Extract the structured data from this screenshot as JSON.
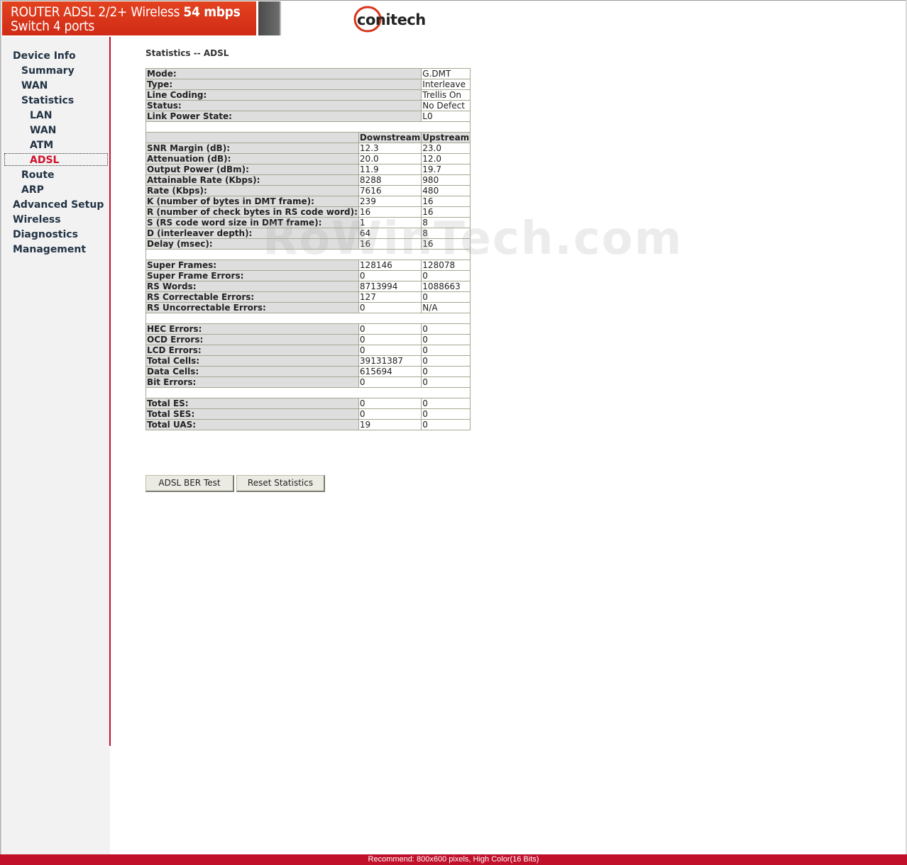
{
  "header": {
    "brand_line1_prefix": "ROUTER ADSL 2/2+ Wireless ",
    "brand_line1_bold": "54 mbps",
    "brand_line2": "Switch 4 ports",
    "logo_text": "conitech",
    "colors": {
      "brand_red": "#d8341a",
      "accent_red": "#c8102e"
    }
  },
  "sidebar": {
    "items": [
      {
        "label": "Device Info",
        "level": 0
      },
      {
        "label": "Summary",
        "level": 1
      },
      {
        "label": "WAN",
        "level": 1
      },
      {
        "label": "Statistics",
        "level": 1
      },
      {
        "label": "LAN",
        "level": 2
      },
      {
        "label": "WAN",
        "level": 2
      },
      {
        "label": "ATM",
        "level": 2
      },
      {
        "label": "ADSL",
        "level": 2,
        "active": true
      },
      {
        "label": "Route",
        "level": 1
      },
      {
        "label": "ARP",
        "level": 1
      },
      {
        "label": "Advanced Setup",
        "level": 0
      },
      {
        "label": "Wireless",
        "level": 0
      },
      {
        "label": "Diagnostics",
        "level": 0
      },
      {
        "label": "Management",
        "level": 0
      }
    ]
  },
  "main": {
    "title": "Statistics -- ADSL",
    "info": [
      {
        "label": "Mode:",
        "value": "G.DMT"
      },
      {
        "label": "Type:",
        "value": "Interleave"
      },
      {
        "label": "Line Coding:",
        "value": "Trellis On"
      },
      {
        "label": "Status:",
        "value": "No Defect"
      },
      {
        "label": "Link Power State:",
        "value": "L0"
      }
    ],
    "columns": {
      "downstream": "Downstream",
      "upstream": "Upstream"
    },
    "line_stats": [
      {
        "label": "SNR Margin (dB):",
        "down": "12.3",
        "up": "23.0"
      },
      {
        "label": "Attenuation (dB):",
        "down": "20.0",
        "up": "12.0"
      },
      {
        "label": "Output Power (dBm):",
        "down": "11.9",
        "up": "19.7"
      },
      {
        "label": "Attainable Rate (Kbps):",
        "down": "8288",
        "up": "980"
      },
      {
        "label": "Rate (Kbps):",
        "down": "7616",
        "up": "480"
      },
      {
        "label": "K (number of bytes in DMT frame):",
        "down": "239",
        "up": "16"
      },
      {
        "label": "R (number of check bytes in RS code word):",
        "down": "16",
        "up": "16"
      },
      {
        "label": "S (RS code word size in DMT frame):",
        "down": "1",
        "up": "8"
      },
      {
        "label": "D (interleaver depth):",
        "down": "64",
        "up": "8"
      },
      {
        "label": "Delay (msec):",
        "down": "16",
        "up": "16"
      }
    ],
    "frame_stats": [
      {
        "label": "Super Frames:",
        "down": "128146",
        "up": "128078"
      },
      {
        "label": "Super Frame Errors:",
        "down": "0",
        "up": "0"
      },
      {
        "label": "RS Words:",
        "down": "8713994",
        "up": "1088663"
      },
      {
        "label": "RS Correctable Errors:",
        "down": "127",
        "up": "0"
      },
      {
        "label": "RS Uncorrectable Errors:",
        "down": "0",
        "up": "N/A"
      }
    ],
    "atm_stats": [
      {
        "label": "HEC Errors:",
        "down": "0",
        "up": "0"
      },
      {
        "label": "OCD Errors:",
        "down": "0",
        "up": "0"
      },
      {
        "label": "LCD Errors:",
        "down": "0",
        "up": "0"
      },
      {
        "label": "Total Cells:",
        "down": "39131387",
        "up": "0"
      },
      {
        "label": "Data Cells:",
        "down": "615694",
        "up": "0"
      },
      {
        "label": "Bit Errors:",
        "down": "0",
        "up": "0"
      }
    ],
    "error_seconds": [
      {
        "label": "Total ES:",
        "down": "0",
        "up": "0"
      },
      {
        "label": "Total SES:",
        "down": "0",
        "up": "0"
      },
      {
        "label": "Total UAS:",
        "down": "19",
        "up": "0"
      }
    ],
    "buttons": {
      "ber_test": "ADSL BER Test",
      "reset": "Reset Statistics"
    },
    "watermark": "RoWinTech.com"
  },
  "footer": {
    "text": "Recommend: 800x600 pixels, High Color(16 Bits)"
  }
}
